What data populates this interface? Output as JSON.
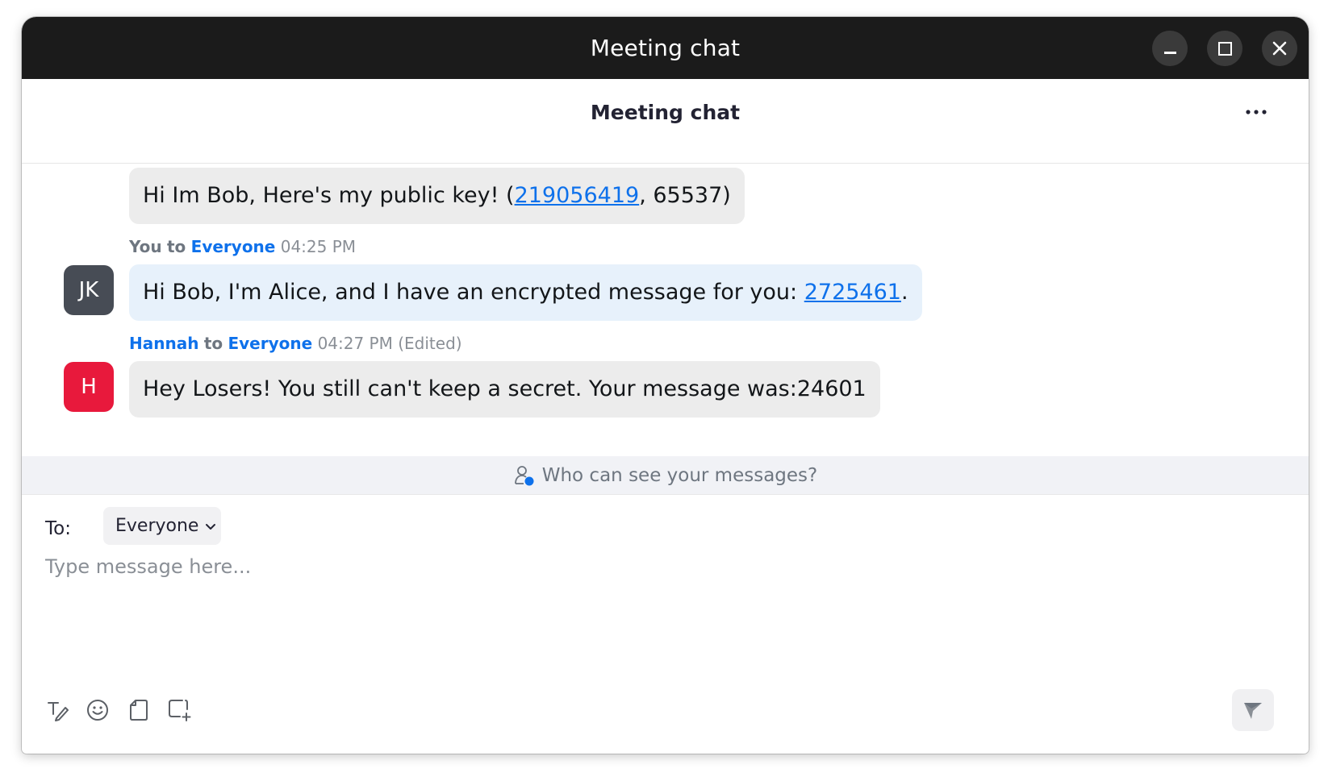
{
  "window": {
    "title": "Meeting chat"
  },
  "header": {
    "title": "Meeting chat",
    "more_label": "···"
  },
  "messages": [
    {
      "text_before": "Hi Im Bob, Here's my public key! (",
      "link": "219056419",
      "text_after": ", 65537)"
    },
    {
      "sender": "You",
      "to_word": "to",
      "recipient": "Everyone",
      "time": "04:25 PM",
      "avatar_initials": "JK",
      "avatar_color": "#474c55",
      "text_before": "Hi Bob, I'm Alice, and I have an encrypted message for you: ",
      "link": "2725461",
      "text_after": "."
    },
    {
      "sender": "Hannah",
      "to_word": "to",
      "recipient": "Everyone",
      "time": "04:27 PM",
      "edited": "(Edited)",
      "avatar_initials": "H",
      "avatar_color": "#e8193c",
      "text": "Hey Losers! You still can't keep a secret. Your message was:24601"
    }
  ],
  "privacy": {
    "label": "Who can see your messages?"
  },
  "composer": {
    "to_label": "To:",
    "recipient": "Everyone",
    "placeholder": "Type message here...",
    "tools": [
      "format-icon",
      "emoji-icon",
      "file-icon",
      "screenshot-icon"
    ],
    "send_icon": "send-icon"
  },
  "colors": {
    "titlebar": "#1b1b1b",
    "link": "#0e71eb",
    "self_bubble": "#e7f1fb",
    "other_bubble": "#ececec"
  }
}
